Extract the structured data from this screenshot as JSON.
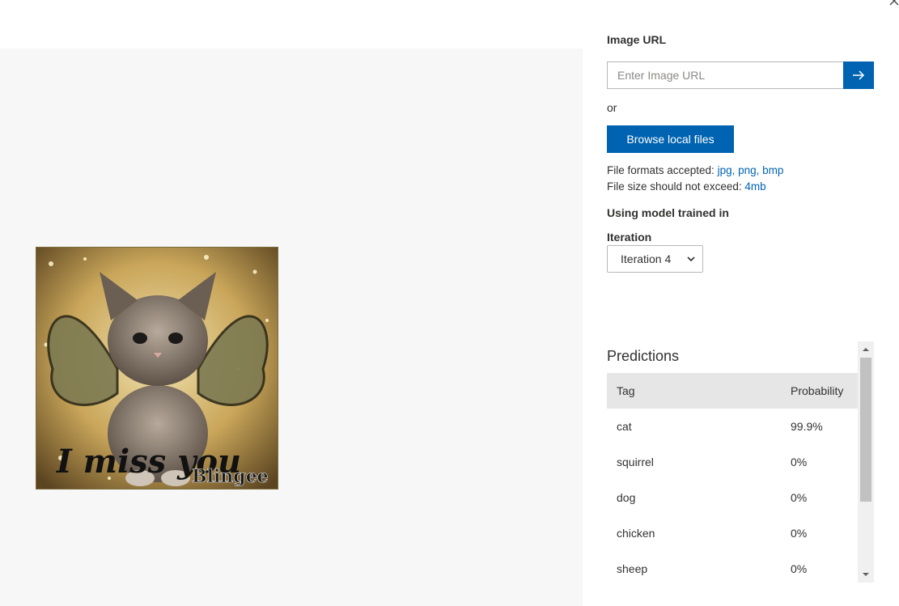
{
  "image_url": {
    "label": "Image URL",
    "placeholder": "Enter Image URL",
    "go_icon": "arrow-right-icon"
  },
  "or_text": "or",
  "browse_label": "Browse local files",
  "file_formats": {
    "prefix": "File formats accepted:",
    "formats": "jpg, png, bmp"
  },
  "file_size": {
    "prefix": "File size should not exceed:",
    "limit": "4mb"
  },
  "model_label": "Using model trained in",
  "iteration": {
    "label": "Iteration",
    "selected": "Iteration 4"
  },
  "predictions": {
    "title": "Predictions",
    "columns": [
      "Tag",
      "Probability"
    ],
    "rows": [
      {
        "tag": "cat",
        "probability": "99.9%"
      },
      {
        "tag": "squirrel",
        "probability": "0%"
      },
      {
        "tag": "dog",
        "probability": "0%"
      },
      {
        "tag": "chicken",
        "probability": "0%"
      },
      {
        "tag": "sheep",
        "probability": "0%"
      }
    ]
  },
  "image_caption": {
    "text": "I miss you",
    "watermark": "Blingee"
  },
  "colors": {
    "accent": "#0063b1",
    "preview_bg": "#f7f7f7",
    "table_header": "#e6e6e6"
  }
}
